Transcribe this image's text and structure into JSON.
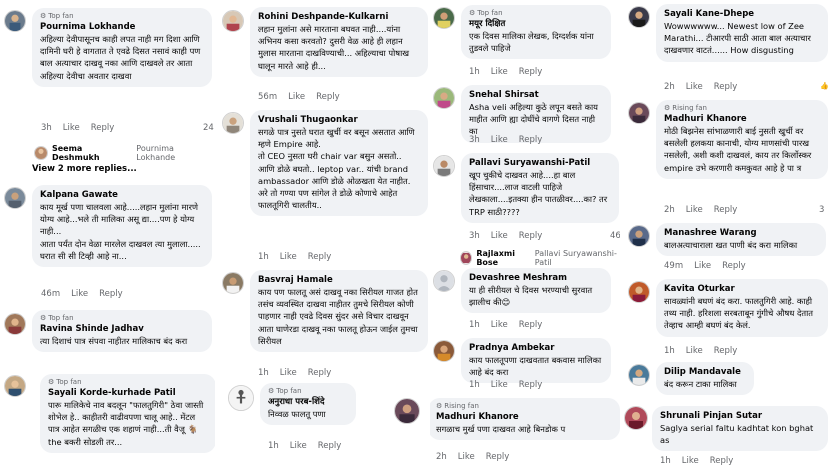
{
  "badges": {
    "top_fan": "Top fan",
    "rising_fan": "Rising fan"
  },
  "actions": {
    "like": "Like",
    "reply": "Reply"
  },
  "col1": [
    {
      "badge": "Top fan",
      "name": "Pournima Lokhande",
      "text": "अहिल्या देवीपासूनच काही लपत नाही मग दिशा आणि दामिनी घरी हे वागतात ते एवढे दिसत नसावं काही पण बाल अत्याचार दाखवू नका आणि दाखवले तर आता अहिल्या देवीचा अवतार दाखवा",
      "time": "3h",
      "cut": "24",
      "reply_name": "Seema Deshmukh",
      "reply_text": "Pournima Lokhande",
      "more": "View 2 more replies..."
    },
    {
      "badge": "",
      "name": "Kalpana Gawate",
      "text": "काय मूर्ख पणा चालवला आहे.....लहान मुलांना मारणे योग्य आहे...भले ती मालिका असू द्या....पण हे योग्य नाही...\nआता पर्यंत दोन वेळा मारलेल दाखवल त्या मुलाला..... घरात सी सी टिव्ही आहे ना...",
      "time": "46m"
    },
    {
      "badge": "Top fan",
      "name": "Ravina Shinde Jadhav",
      "text": "त्या दिशाचं पात्र संपवा नाहीतर मालिकाच बंद करा"
    },
    {
      "badge": "Top fan",
      "name": "Sayali Korde-kurhade Patil",
      "text": "पारू मालिकेचे नाव बदलून \"फालतुगिरी\" ठेवा जास्ती शोभेल हे.. काहीतरी वाढीवपणा चालू आहे.. मेंटल पात्र आहेत सगळीच एक शहाणं नाही...ती वैजू 🐐 the बकरी सोडली तर..."
    }
  ],
  "col2": [
    {
      "badge": "",
      "name": "Rohini Deshpande-Kulkarni",
      "text": "लहान मुलांना असे मारताना बघवत नाही....यांना अभिनय कसा करवतो? दुसरी वेळ आहे ही लहान मुलास मारताना दाखविण्याची... अहिल्याचा पोषाख घालून मारते आहे ही...",
      "time": "56m"
    },
    {
      "badge": "",
      "name": "Vrushali Thugaonkar",
      "text": "सगळे पात्र नुसते घरात खुर्ची वर बसून असतात आणि म्हणे Empire आहे.\nतो CEO नुसता घरी chair var बसुन असतो.. आणि डोळे बघतो.. leptop var.. यांची brand ambassador आणि डोळे ओळखता येत नाहीत.\nअरे तो गण्या पण सांगेल ते डोळे कोणाचे आहेत फालतूगिरी चालतीय..",
      "time": "1h"
    },
    {
      "badge": "",
      "name": "Basvraj Hamale",
      "text": "काय पण फालतू असं दाखवू नका सिरीयल गाजत होत तसंच व्यवस्थित दाखवा नाहीतर तुमचे सिरीयल कोणी पाहणार नाही एवढे दिवस सुंदर असे विचार दाखवून आता घाणेरडा दाखवू नका फालतू होऊन जाईल तुमचा सिरीयल",
      "time": "1h"
    },
    {
      "badge": "Top fan",
      "name": "अनुराधा परब-शिंदे",
      "text": "निव्वळ फालतू पणा",
      "time": "1h"
    }
  ],
  "col3": [
    {
      "badge": "Top fan",
      "name": "मयूर दिक्षित",
      "text": "एक दिवस मालिका लेखक, दिग्दर्शक यांना तुडवले पाहिजे",
      "time": "1h"
    },
    {
      "badge": "",
      "name": "Snehal Shirsat",
      "text": "Asha veli अहिल्या कुठे लपून बसते काय माहीत आणि ह्या दोघींचे वागणे दिसत नाही का",
      "time": "3h"
    },
    {
      "badge": "",
      "name": "Pallavi Suryawanshi-Patil",
      "text": "खूप चुकीचे दाखवत आहे....हा बाल हिंसाचार....लाज वाटली पाहिजे लेखकाला....इतक्या हीन पातळीवर....का? तर TRP साठी????",
      "time": "3h",
      "cut": "46",
      "reply_name": "Rajlaxmi Bose",
      "reply_text": "Pallavi Suryawanshi-Patil"
    },
    {
      "badge": "",
      "name": "Devashree Meshram",
      "text": "या ही सीरीयल चे दिवस भरण्याची सुरवात झालीच की😊",
      "time": "1h"
    },
    {
      "badge": "",
      "name": "Pradnya Ambekar",
      "text": "काय फालतूपणा दाखवतात बकवास मालिका आहे बंद करा",
      "time": "1h"
    },
    {
      "badge": "Rising fan",
      "name": "Madhuri Khanore",
      "text": "सगळाच मुर्ख पणा दाखवत आहे  बिनडोक प",
      "time": "2h"
    }
  ],
  "col4": [
    {
      "badge": "",
      "name": "Sayali Kane-Dhepe",
      "text": "Wowwwwww... Newest low of Zee Marathi... टीआरपी साठी आता बाल अत्याचार दाखवणार वाटतं...... How disgusting",
      "time": "2h"
    },
    {
      "badge": "Rising fan",
      "name": "Madhuri Khanore",
      "text": "मोठी बिझनेस सांभाळणारी बाई नुसती खुर्ची वर बसलेली हलकया कानाची, योग्य माणसांची पारख नसलेली, अशी कशी दाखवलं, काय तर किर्लोस्कर empire  उभे करणारी  कमकुवत आहे हे पा त्र",
      "time": "2h",
      "cut": "3"
    },
    {
      "badge": "",
      "name": "Manashree Warang",
      "text": "बालअत्याचाराला खत पाणी  बंद करा मालिका",
      "time": "49m"
    },
    {
      "badge": "",
      "name": "Kavita Oturkar",
      "text": "सावळ्यांनी बघणं बंद करा. फालतुगिरी आहे. काही तथ्य नाही. हरिशला सरबताबून गुंगीचे औषध देतात तेव्हाच आम्ही बघणं बंद केलं.",
      "time": "1h"
    },
    {
      "badge": "",
      "name": "Dilip Mandavale",
      "text": "बंद करून टाका मालिका",
      "time": "1h"
    },
    {
      "badge": "",
      "name": "Shrunali Pinjan Sutar",
      "text": "Saglya serial faltu kadhtat kon bghat as",
      "time": "1h"
    }
  ]
}
